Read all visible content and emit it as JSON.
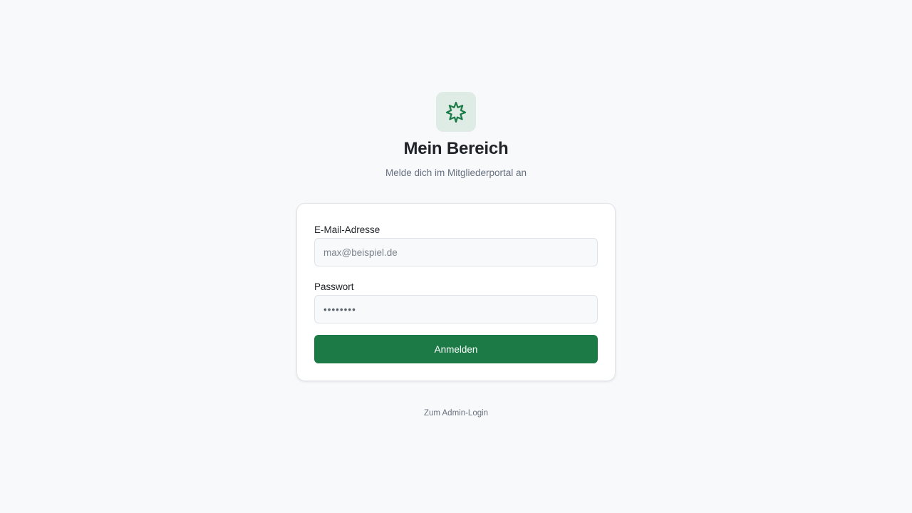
{
  "brand": {
    "icon": "leaf-icon",
    "icon_color": "#1b7a45",
    "tile_color": "#dfece5"
  },
  "header": {
    "title": "Mein Bereich",
    "subtitle": "Melde dich im Mitgliederportal an"
  },
  "login_form": {
    "email": {
      "label": "E-Mail-Adresse",
      "placeholder": "max@beispiel.de",
      "value": ""
    },
    "password": {
      "label": "Passwort",
      "value": "••••••••"
    },
    "submit_label": "Anmelden",
    "submit_color": "#1b7a45"
  },
  "footer": {
    "admin_link_label": "Zum Admin-Login"
  }
}
